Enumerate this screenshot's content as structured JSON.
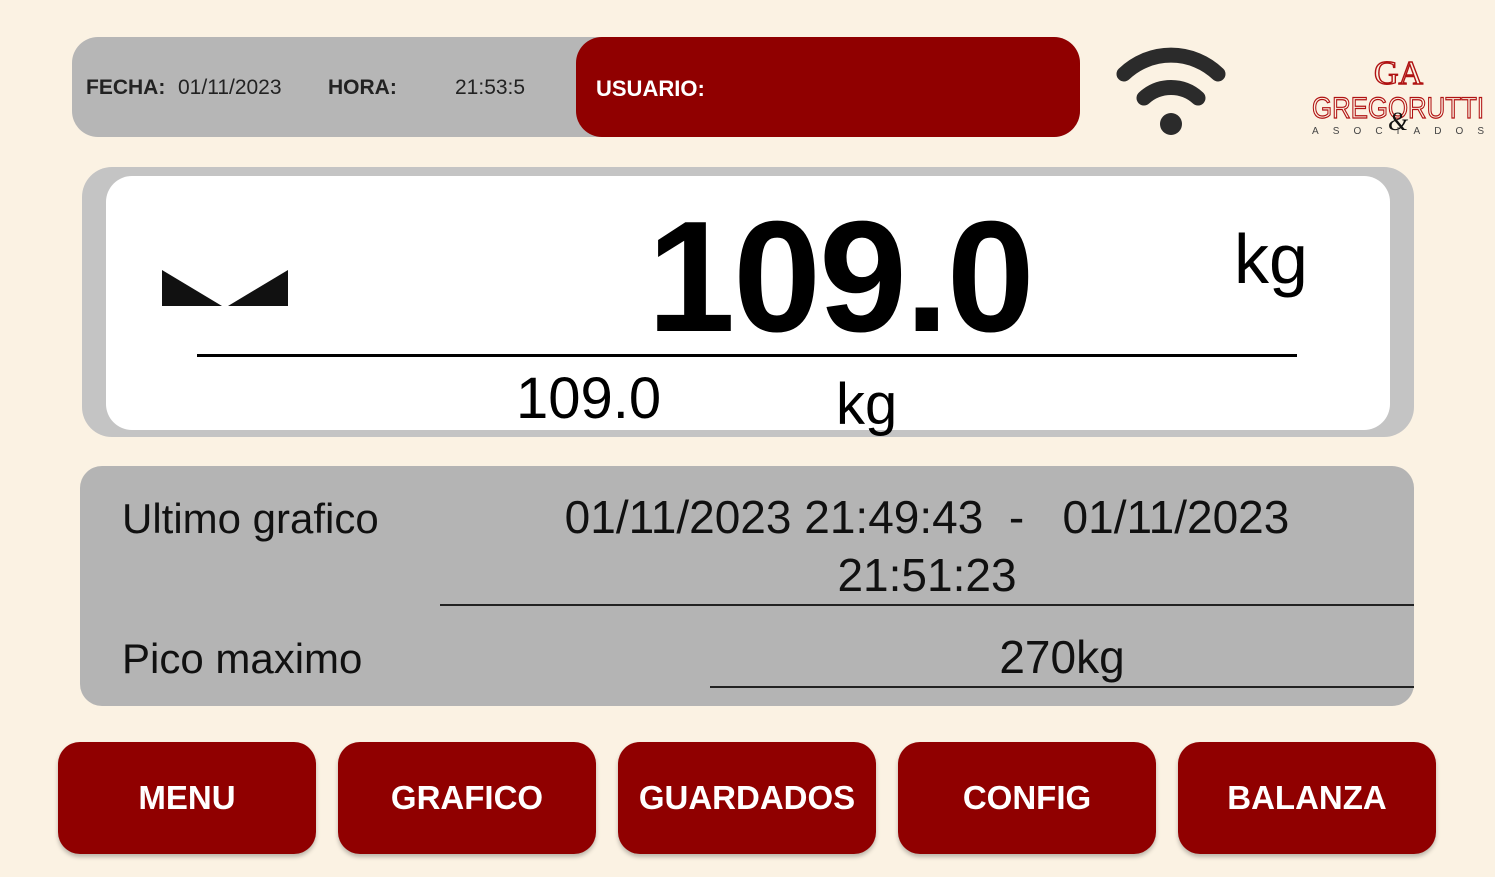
{
  "header": {
    "date_label": "FECHA:",
    "date_value": "01/11/2023",
    "time_label": "HORA:",
    "time_value": "21:53:5",
    "user_label": "USUARIO:",
    "user_value": ""
  },
  "logo": {
    "monogram": "GA",
    "name": "GREGORUTTI",
    "ampersand": "&",
    "subtitle": "ASOCIADOS"
  },
  "display": {
    "main_weight": "109.0",
    "main_unit": "kg",
    "secondary_weight": "109.0",
    "secondary_unit": "kg",
    "stable_indicator_icon": "stable-triangles-icon"
  },
  "info": {
    "last_chart_label": "Ultimo grafico",
    "last_chart_range_line1": "01/11/2023 21:49:43  -   01/11/2023",
    "last_chart_range_line2": "21:51:23",
    "peak_label": "Pico maximo",
    "peak_value": "270kg"
  },
  "buttons": [
    {
      "label": "MENU"
    },
    {
      "label": "GRAFICO"
    },
    {
      "label": "GUARDADOS"
    },
    {
      "label": "CONFIG"
    },
    {
      "label": "BALANZA"
    }
  ],
  "colors": {
    "background": "#fbf2e3",
    "accent_red": "#900000",
    "panel_gray": "#b4b4b4",
    "display_white": "#ffffff"
  },
  "icons": {
    "wifi": "wifi-icon"
  }
}
